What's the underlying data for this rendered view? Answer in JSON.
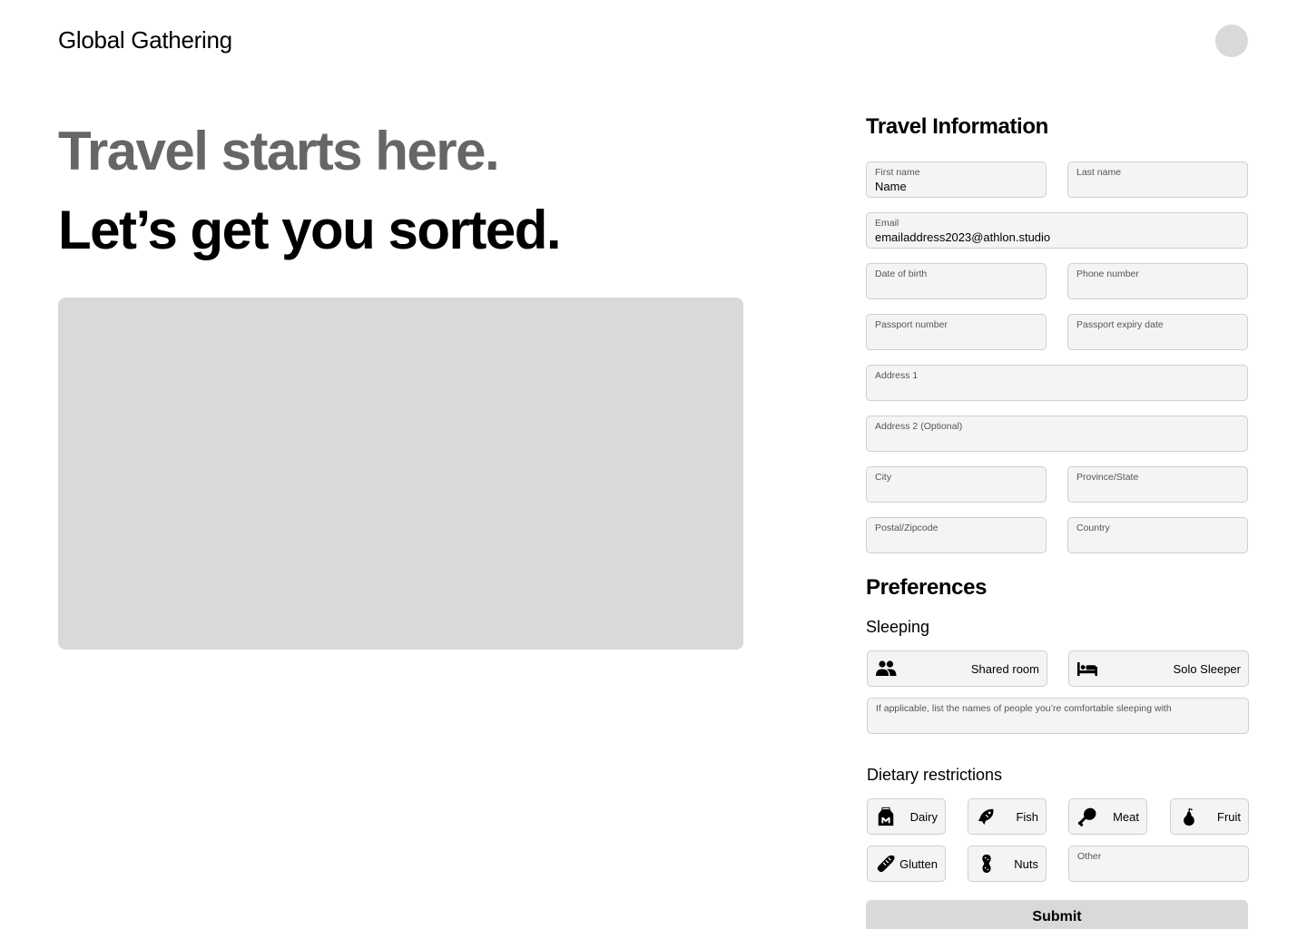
{
  "header": {
    "brand": "Global Gathering"
  },
  "hero": {
    "line1": "Travel starts here.",
    "line2": "Let’s get you sorted."
  },
  "travel": {
    "title": "Travel Information",
    "first_name": {
      "label": "First name",
      "value": "Name"
    },
    "last_name": {
      "label": "Last name",
      "value": ""
    },
    "email": {
      "label": "Email",
      "value": "emailaddress2023@athlon.studio"
    },
    "dob": {
      "label": "Date of birth",
      "value": ""
    },
    "phone": {
      "label": "Phone number",
      "value": ""
    },
    "passport_number": {
      "label": "Passport number",
      "value": ""
    },
    "passport_expiry": {
      "label": "Passport expiry date",
      "value": ""
    },
    "address1": {
      "label": "Address 1",
      "value": ""
    },
    "address2": {
      "label": "Address 2 (Optional)",
      "value": ""
    },
    "city": {
      "label": "City",
      "value": ""
    },
    "province": {
      "label": "Province/State",
      "value": ""
    },
    "postal": {
      "label": "Postal/Zipcode",
      "value": ""
    },
    "country": {
      "label": "Country",
      "value": ""
    }
  },
  "preferences": {
    "title": "Preferences",
    "sleeping": {
      "title": "Sleeping",
      "shared_room": "Shared room",
      "solo_sleeper": "Solo Sleeper",
      "companions": {
        "label": "If applicable, list the names of people you’re comfortable sleeping with",
        "value": ""
      }
    },
    "dietary": {
      "title": "Dietary restrictions",
      "dairy": "Dairy",
      "fish": "Fish",
      "meat": "Meat",
      "fruit": "Fruit",
      "gluten": "Glutten",
      "nuts": "Nuts",
      "other": {
        "label": "Other",
        "value": ""
      }
    }
  },
  "submit_label": "Submit",
  "icons": {
    "avatar": "avatar-circle",
    "shared_room": "people-icon",
    "solo_sleeper": "bed-icon",
    "dairy": "milk-carton-icon",
    "fish": "fish-icon",
    "meat": "drumstick-icon",
    "fruit": "pear-icon",
    "gluten": "bread-icon",
    "nuts": "peanut-icon"
  },
  "colors": {
    "hero_muted": "#666666",
    "field_bg": "#f4f4f4",
    "field_border": "#cfcfcf",
    "placeholder_gray": "#d9d9d9"
  }
}
